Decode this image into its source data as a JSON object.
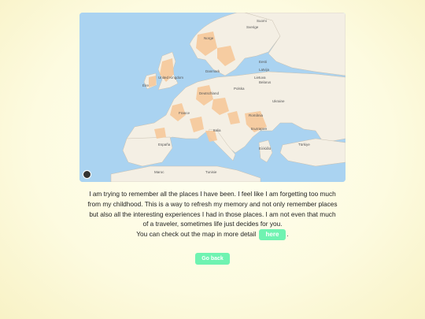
{
  "map": {
    "labels": {
      "sverige": "Sverige",
      "norge": "Norge",
      "suomi": "Suomi",
      "eesti": "Eesti",
      "latvija": "Latvija",
      "lietuva": "Lietuva",
      "belarus": "Belarus",
      "polska": "Polska",
      "ukraine": "Ukraine",
      "deutschland": "Deutschland",
      "france": "France",
      "espana": "España",
      "italia": "Italia",
      "romania": "România",
      "bulgaria": "България",
      "turkiye": "Türkiye",
      "ellada": "Ελλάδα",
      "maroc": "Maroc",
      "tunisie": "Tunisie",
      "uk": "United Kingdom",
      "eire": "Éire",
      "danmark": "Danmark"
    },
    "colors": {
      "water": "#aad3f1",
      "land": "#f4efe4",
      "visited": "#f6c899"
    }
  },
  "description": {
    "text": "I am trying to remember all the places I have been. I feel like I am forgetting too much from my childhood. This is a way to refresh my memory and not only remember places but also all the interesting experiences I had in those places. I am not even that much of a traveler, sometimes life just decides for you.",
    "map_link_prefix": "You can check out the map in more detail",
    "here_label": "here",
    "map_link_suffix": "."
  },
  "go_back_label": "Go back",
  "accent_color": "#6ff3b1"
}
